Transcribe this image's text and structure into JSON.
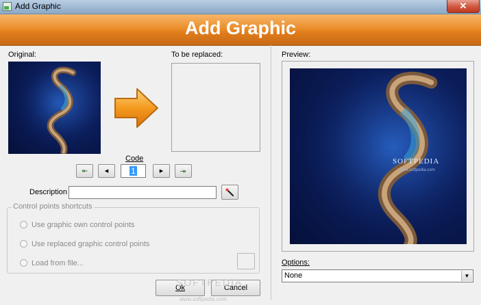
{
  "window": {
    "title": "Add Graphic",
    "banner_title": "Add Graphic",
    "close_label": "✕"
  },
  "original": {
    "label": "Original:"
  },
  "to_be_replaced": {
    "label": "To be replaced:"
  },
  "code": {
    "label": "Code",
    "value": "1",
    "first_button": "⯬",
    "prev_button": "◂",
    "next_button": "▸",
    "last_button": "⯮"
  },
  "description": {
    "label": "Description",
    "value": "",
    "picker_icon": "magic-wand-icon"
  },
  "control_points": {
    "group_label": "Control points shortcuts",
    "options": [
      {
        "label": "Use graphic own control points"
      },
      {
        "label": "Use replaced graphic control points"
      },
      {
        "label": "Load from file..."
      }
    ]
  },
  "buttons": {
    "ok": "Ok",
    "cancel": "Cancel"
  },
  "preview": {
    "label": "Preview:",
    "watermark": "SOFTPEDIA",
    "url_text": "www.softpedia.com"
  },
  "options": {
    "label": "Options:",
    "selected": "None"
  },
  "footer_watermark": {
    "text": "SOFTPEDIA",
    "url": "www.softpedia.com"
  },
  "colors": {
    "banner": "#eb8f2c",
    "ocean": "#0b1d5a",
    "selection": "#3399ff"
  }
}
